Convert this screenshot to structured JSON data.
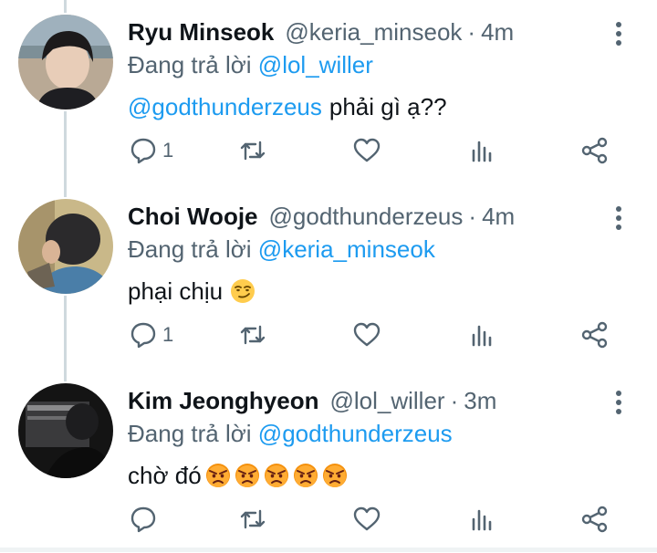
{
  "tweets": [
    {
      "name": "Ryu Minseok",
      "handle": "@keria_minseok",
      "separator": "·",
      "time": "4m",
      "reply_prefix": "Đang trả lời",
      "reply_to": "@lol_willer",
      "mention": "@godthunderzeus",
      "text": "phải gì ạ??",
      "reply_count": "1",
      "emoji": []
    },
    {
      "name": "Choi Wooje",
      "handle": "@godthunderzeus",
      "separator": "·",
      "time": "4m",
      "reply_prefix": "Đang trả lời",
      "reply_to": "@keria_minseok",
      "mention": "",
      "text": "phại chịu",
      "reply_count": "1",
      "emoji": [
        "smirking-face"
      ]
    },
    {
      "name": "Kim Jeonghyeon",
      "handle": "@lol_willer",
      "separator": "·",
      "time": "3m",
      "reply_prefix": "Đang trả lời",
      "reply_to": "@godthunderzeus",
      "mention": "",
      "text": "chờ đó",
      "reply_count": "",
      "emoji": [
        "angry-face",
        "angry-face",
        "angry-face",
        "angry-face",
        "angry-face"
      ]
    }
  ],
  "icons": {
    "reply": "speech-bubble-icon",
    "retweet": "retweet-arrows-icon",
    "like": "heart-icon",
    "views": "bar-chart-icon",
    "share": "share-nodes-icon",
    "more": "vertical-ellipsis-icon"
  },
  "colors": {
    "link": "#1d9bf0",
    "muted": "#536471",
    "text": "#0f1419",
    "thread_line": "#cfd9de"
  }
}
